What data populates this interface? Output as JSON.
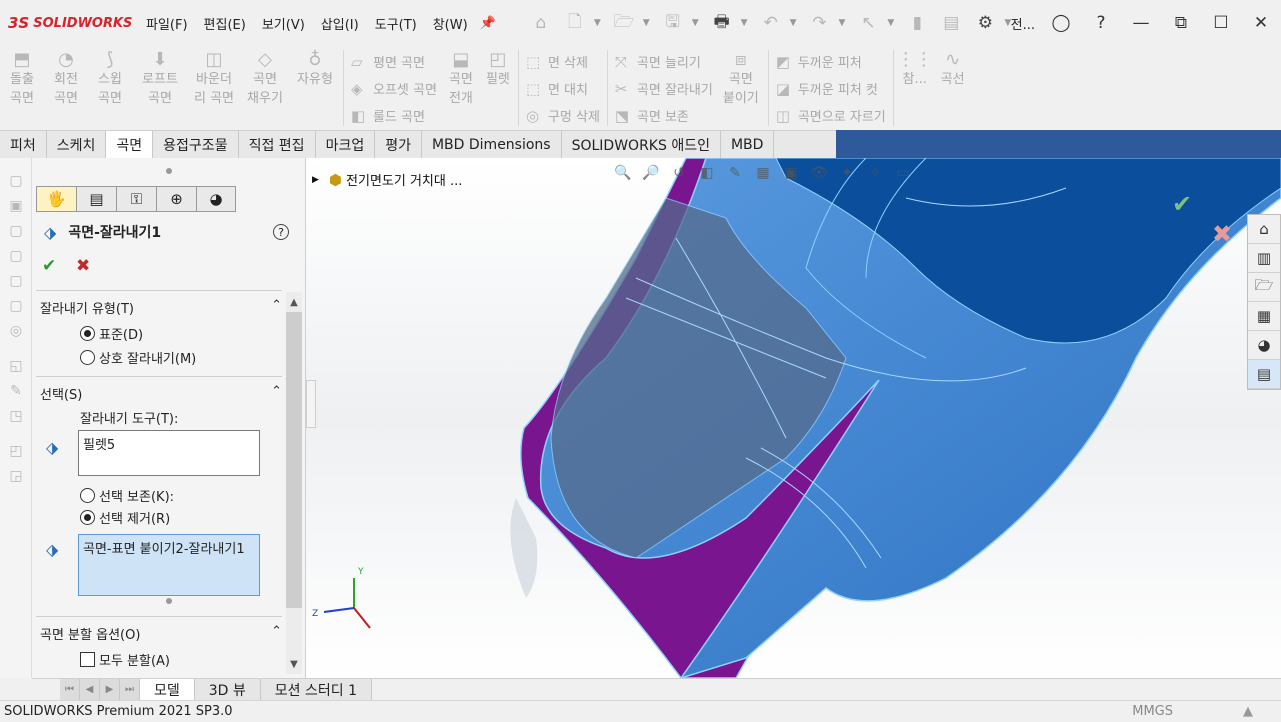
{
  "app": {
    "logo_prefix": "3S",
    "logo_name": "SOLIDWORKS",
    "title_truncated": "전...",
    "menus": [
      "파일(F)",
      "편집(E)",
      "보기(V)",
      "삽입(I)",
      "도구(T)",
      "창(W)"
    ]
  },
  "command_manager": {
    "big_left": [
      {
        "label": "돌출\n곡면"
      },
      {
        "label": "회전\n곡면"
      },
      {
        "label": "스윕\n곡면"
      },
      {
        "label": "로프트\n곡면"
      },
      {
        "label": "바운더\n리 곡면"
      },
      {
        "label": "곡면\n채우기"
      },
      {
        "label": "자유형"
      }
    ],
    "col1": [
      "평면 곡면",
      "오프셋 곡면",
      "룰드 곡면"
    ],
    "big_mid1": "곡면\n전개",
    "big_mid2": "필렛",
    "col2": [
      "면 삭제",
      "면 대치",
      "구멍 삭제"
    ],
    "col3": [
      "곡면 늘리기",
      "곡면 잘라내기",
      "곡면 보존"
    ],
    "big_mid3": "곡면\n붙이기",
    "col4": [
      "두꺼운 피처",
      "두꺼운 피처 컷",
      "곡면으로 자르기"
    ],
    "big_right1": "참...",
    "big_right2": "곡선"
  },
  "tabs": [
    "피처",
    "스케치",
    "곡면",
    "용접구조물",
    "직접 편집",
    "마크업",
    "평가",
    "MBD Dimensions",
    "SOLIDWORKS 애드인",
    "MBD"
  ],
  "active_tab": "곡면",
  "property_manager": {
    "title": "곡면-잘라내기1",
    "help": "?",
    "ok": "✔",
    "cancel": "✖",
    "trim_type": {
      "header": "잘라내기 유형(T)",
      "options": [
        "표준(D)",
        "상호 잘라내기(M)"
      ],
      "selected": 0
    },
    "selection": {
      "header": "선택(S)",
      "trim_tool_label": "잘라내기 도구(T):",
      "trim_tool_value": "필렛5",
      "keep_remove_options": [
        "선택 보존(K):",
        "선택 제거(R)"
      ],
      "selected": 1,
      "pieces_value": "곡면-표면 붙이기2-잘라내기1"
    },
    "split_options": {
      "header": "곡면 분할 옵션(O)",
      "split_all_label": "모두 분할(A)"
    }
  },
  "viewport": {
    "tree_path": "전기면도기 거치대  ...",
    "colors": {
      "surface_blue": "#3f86d4",
      "surface_dark": "#0b4e9c",
      "surface_purple": "#7a1590",
      "edge_light": "#8fd0ff"
    },
    "triad": {
      "y": "Y",
      "z": "Z"
    }
  },
  "bottom_tabs": [
    "모델",
    "3D 뷰",
    "모션 스터디 1"
  ],
  "active_bottom_tab": "모델",
  "status": {
    "text": "SOLIDWORKS Premium 2021 SP3.0",
    "units": "MMGS"
  }
}
